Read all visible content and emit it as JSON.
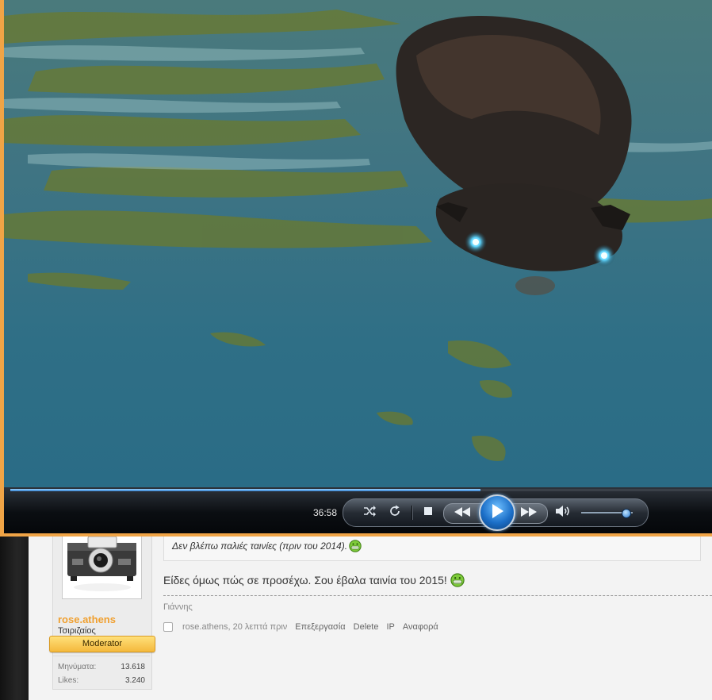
{
  "player": {
    "elapsed_time": "36:58",
    "progress_fraction": 0.67,
    "volume_fraction": 0.86,
    "icons": {
      "shuffle": "shuffle-icon",
      "repeat": "repeat-icon",
      "stop": "stop-icon",
      "previous": "previous-icon",
      "play": "play-icon",
      "next": "next-icon",
      "volume": "volume-icon"
    },
    "colors": {
      "frame": "#f0a446",
      "seek": "#2f7fd0"
    }
  },
  "post": {
    "quote_text": "Δεν βλέπω παλιές ταινίες (πριν του 2014).",
    "message": "Είδες όμως πώς σε προσέχω. Σου έβαλα ταινία του 2015!",
    "signature": "Γιάννης",
    "meta_author": "rose.athens, 20 λεπτά πριν",
    "actions": [
      "Επεξεργασία",
      "Delete",
      "IP",
      "Αναφορά"
    ]
  },
  "user": {
    "username": "rose.athens",
    "title": "Τσιριζαίος",
    "role": "Moderator",
    "stats": [
      {
        "label": "Μηνύματα:",
        "value": "13.618"
      },
      {
        "label": "Likes:",
        "value": "3.240"
      }
    ],
    "colors": {
      "username": "#f0a030",
      "badge": "#f4b93c"
    }
  }
}
